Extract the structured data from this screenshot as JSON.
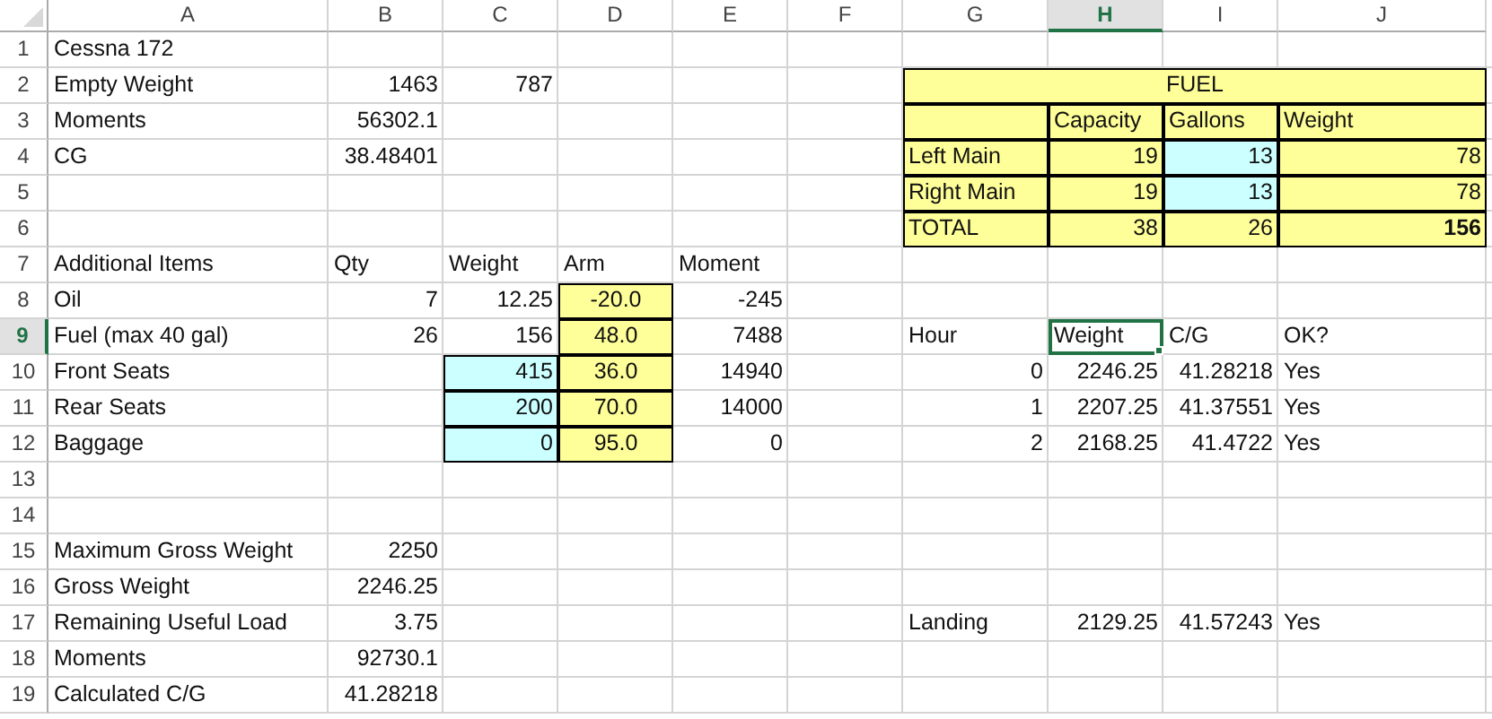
{
  "columns": [
    {
      "label": "A",
      "selected": false
    },
    {
      "label": "B",
      "selected": false
    },
    {
      "label": "C",
      "selected": false
    },
    {
      "label": "D",
      "selected": false
    },
    {
      "label": "E",
      "selected": false
    },
    {
      "label": "F",
      "selected": false
    },
    {
      "label": "G",
      "selected": false
    },
    {
      "label": "H",
      "selected": true
    },
    {
      "label": "I",
      "selected": false
    },
    {
      "label": "J",
      "selected": false
    }
  ],
  "rows": [
    {
      "number": "1",
      "selected": false,
      "cells": [
        {
          "text": "Cessna 172",
          "kind": "text",
          "selected": false
        },
        null,
        null,
        null,
        null,
        null,
        null,
        null,
        null,
        null
      ]
    },
    {
      "number": "2",
      "selected": false,
      "cells": [
        {
          "text": "Empty Weight",
          "kind": "text",
          "selected": false
        },
        {
          "text": "1463",
          "kind": "number",
          "selected": false
        },
        {
          "text": "787",
          "kind": "number",
          "selected": false
        },
        null,
        null,
        null,
        {
          "text": "FUEL",
          "kind": "centered",
          "color": "#ffff99",
          "bordered": true,
          "selected": false
        },
        {
          "merged": true
        },
        {
          "merged": true
        },
        {
          "merged": true
        }
      ]
    },
    {
      "number": "3",
      "selected": false,
      "cells": [
        {
          "text": "Moments",
          "kind": "text",
          "selected": false
        },
        {
          "text": "56302.1",
          "kind": "number",
          "selected": false
        },
        null,
        null,
        null,
        null,
        {
          "color": "#ffff99",
          "bordered": true,
          "selected": false
        },
        {
          "text": "Capacity",
          "kind": "text",
          "color": "#ffff99",
          "bordered": true,
          "selected": false
        },
        {
          "text": "Gallons",
          "kind": "text",
          "color": "#ffff99",
          "bordered": true,
          "selected": false
        },
        {
          "text": "Weight",
          "kind": "text",
          "color": "#ffff99",
          "bordered": true,
          "selected": false
        }
      ]
    },
    {
      "number": "4",
      "selected": false,
      "cells": [
        {
          "text": "CG",
          "kind": "text",
          "selected": false
        },
        {
          "text": "38.48401",
          "kind": "number",
          "selected": false
        },
        null,
        null,
        null,
        null,
        {
          "text": "Left Main",
          "kind": "text",
          "color": "#ffff99",
          "bordered": true,
          "selected": false
        },
        {
          "text": "19",
          "kind": "number",
          "color": "#ffff99",
          "bordered": true,
          "selected": false
        },
        {
          "text": "13",
          "kind": "number",
          "color": "#ccffff",
          "bordered": true,
          "selected": false
        },
        {
          "text": "78",
          "kind": "number",
          "color": "#ffff99",
          "bordered": true,
          "selected": false
        }
      ]
    },
    {
      "number": "5",
      "selected": false,
      "cells": [
        null,
        null,
        null,
        null,
        null,
        null,
        {
          "text": "Right Main",
          "kind": "text",
          "color": "#ffff99",
          "bordered": true,
          "selected": false
        },
        {
          "text": "19",
          "kind": "number",
          "color": "#ffff99",
          "bordered": true,
          "selected": false
        },
        {
          "text": "13",
          "kind": "number",
          "color": "#ccffff",
          "bordered": true,
          "selected": false
        },
        {
          "text": "78",
          "kind": "number",
          "color": "#ffff99",
          "bordered": true,
          "selected": false
        }
      ]
    },
    {
      "number": "6",
      "selected": false,
      "cells": [
        null,
        null,
        null,
        null,
        null,
        null,
        {
          "text": "TOTAL",
          "kind": "text",
          "color": "#ffff99",
          "bordered": true,
          "selected": false
        },
        {
          "text": "38",
          "kind": "number",
          "color": "#ffff99",
          "bordered": true,
          "selected": false
        },
        {
          "text": "26",
          "kind": "number",
          "color": "#ffff99",
          "bordered": true,
          "selected": false
        },
        {
          "text": "156",
          "kind": "number",
          "color": "#ffff99",
          "bordered": true,
          "bold": true,
          "selected": false
        }
      ]
    },
    {
      "number": "7",
      "selected": false,
      "cells": [
        {
          "text": "Additional Items",
          "kind": "text",
          "selected": false
        },
        {
          "text": "Qty",
          "kind": "text",
          "selected": false
        },
        {
          "text": "Weight",
          "kind": "text",
          "selected": false
        },
        {
          "text": "Arm",
          "kind": "text",
          "selected": false
        },
        {
          "text": "Moment",
          "kind": "text",
          "selected": false
        },
        null,
        null,
        null,
        null,
        null
      ]
    },
    {
      "number": "8",
      "selected": false,
      "cells": [
        {
          "text": "Oil",
          "kind": "text",
          "selected": false
        },
        {
          "text": "7",
          "kind": "number",
          "selected": false
        },
        {
          "text": "12.25",
          "kind": "number",
          "selected": false
        },
        {
          "text": "-20.0",
          "kind": "centered",
          "color": "#ffff99",
          "bordered": true,
          "selected": false
        },
        {
          "text": "-245",
          "kind": "number",
          "selected": false
        },
        null,
        null,
        null,
        null,
        null
      ]
    },
    {
      "number": "9",
      "selected": true,
      "cells": [
        {
          "text": "Fuel (max 40 gal)",
          "kind": "text",
          "selected": false
        },
        {
          "text": "26",
          "kind": "number",
          "selected": false
        },
        {
          "text": "156",
          "kind": "number",
          "selected": false
        },
        {
          "text": "48.0",
          "kind": "centered",
          "color": "#ffff99",
          "bordered": true,
          "selected": false
        },
        {
          "text": "7488",
          "kind": "number",
          "selected": false
        },
        null,
        {
          "text": "Hour",
          "kind": "text",
          "selected": false
        },
        {
          "text": "Weight",
          "kind": "text",
          "selected": true
        },
        {
          "text": "C/G",
          "kind": "text",
          "selected": false
        },
        {
          "text": "OK?",
          "kind": "text",
          "selected": false
        }
      ]
    },
    {
      "number": "10",
      "selected": false,
      "cells": [
        {
          "text": "Front Seats",
          "kind": "text",
          "selected": false
        },
        null,
        {
          "text": "415",
          "kind": "number",
          "color": "#ccffff",
          "bordered": true,
          "selected": false
        },
        {
          "text": "36.0",
          "kind": "centered",
          "color": "#ffff99",
          "bordered": true,
          "selected": false
        },
        {
          "text": "14940",
          "kind": "number",
          "selected": false
        },
        null,
        {
          "text": "0",
          "kind": "number",
          "selected": false
        },
        {
          "text": "2246.25",
          "kind": "number",
          "selected": false
        },
        {
          "text": "41.28218",
          "kind": "number",
          "selected": false
        },
        {
          "text": "Yes",
          "kind": "text",
          "selected": false
        }
      ]
    },
    {
      "number": "11",
      "selected": false,
      "cells": [
        {
          "text": "Rear Seats",
          "kind": "text",
          "selected": false
        },
        null,
        {
          "text": "200",
          "kind": "number",
          "color": "#ccffff",
          "bordered": true,
          "selected": false
        },
        {
          "text": "70.0",
          "kind": "centered",
          "color": "#ffff99",
          "bordered": true,
          "selected": false
        },
        {
          "text": "14000",
          "kind": "number",
          "selected": false
        },
        null,
        {
          "text": "1",
          "kind": "number",
          "selected": false
        },
        {
          "text": "2207.25",
          "kind": "number",
          "selected": false
        },
        {
          "text": "41.37551",
          "kind": "number",
          "selected": false
        },
        {
          "text": "Yes",
          "kind": "text",
          "selected": false
        }
      ]
    },
    {
      "number": "12",
      "selected": false,
      "cells": [
        {
          "text": "Baggage",
          "kind": "text",
          "selected": false
        },
        null,
        {
          "text": "0",
          "kind": "number",
          "color": "#ccffff",
          "bordered": true,
          "selected": false
        },
        {
          "text": "95.0",
          "kind": "centered",
          "color": "#ffff99",
          "bordered": true,
          "selected": false
        },
        {
          "text": "0",
          "kind": "number",
          "selected": false
        },
        null,
        {
          "text": "2",
          "kind": "number",
          "selected": false
        },
        {
          "text": "2168.25",
          "kind": "number",
          "selected": false
        },
        {
          "text": "41.4722",
          "kind": "number",
          "selected": false
        },
        {
          "text": "Yes",
          "kind": "text",
          "selected": false
        }
      ]
    },
    {
      "number": "13",
      "selected": false,
      "cells": [
        null,
        null,
        null,
        null,
        null,
        null,
        null,
        null,
        null,
        null
      ]
    },
    {
      "number": "14",
      "selected": false,
      "cells": [
        null,
        null,
        null,
        null,
        null,
        null,
        null,
        null,
        null,
        null
      ]
    },
    {
      "number": "15",
      "selected": false,
      "cells": [
        {
          "text": "Maximum Gross Weight",
          "kind": "text",
          "selected": false
        },
        {
          "text": "2250",
          "kind": "number",
          "selected": false
        },
        null,
        null,
        null,
        null,
        null,
        null,
        null,
        null
      ]
    },
    {
      "number": "16",
      "selected": false,
      "cells": [
        {
          "text": "Gross Weight",
          "kind": "text",
          "selected": false
        },
        {
          "text": "2246.25",
          "kind": "number",
          "selected": false
        },
        null,
        null,
        null,
        null,
        null,
        null,
        null,
        null
      ]
    },
    {
      "number": "17",
      "selected": false,
      "cells": [
        {
          "text": "Remaining Useful Load",
          "kind": "text",
          "selected": false
        },
        {
          "text": "3.75",
          "kind": "number",
          "selected": false
        },
        null,
        null,
        null,
        null,
        {
          "text": "Landing",
          "kind": "text",
          "selected": false
        },
        {
          "text": "2129.25",
          "kind": "number",
          "selected": false
        },
        {
          "text": "41.57243",
          "kind": "number",
          "selected": false
        },
        {
          "text": "Yes",
          "kind": "text",
          "selected": false
        }
      ]
    },
    {
      "number": "18",
      "selected": false,
      "cells": [
        {
          "text": "Moments",
          "kind": "text",
          "selected": false
        },
        {
          "text": "92730.1",
          "kind": "number",
          "selected": false
        },
        null,
        null,
        null,
        null,
        null,
        null,
        null,
        null
      ]
    },
    {
      "number": "19",
      "selected": false,
      "cells": [
        {
          "text": "Calculated C/G",
          "kind": "text",
          "selected": false
        },
        {
          "text": "41.28218",
          "kind": "number",
          "selected": false
        },
        null,
        null,
        null,
        null,
        null,
        null,
        null,
        null
      ]
    }
  ]
}
